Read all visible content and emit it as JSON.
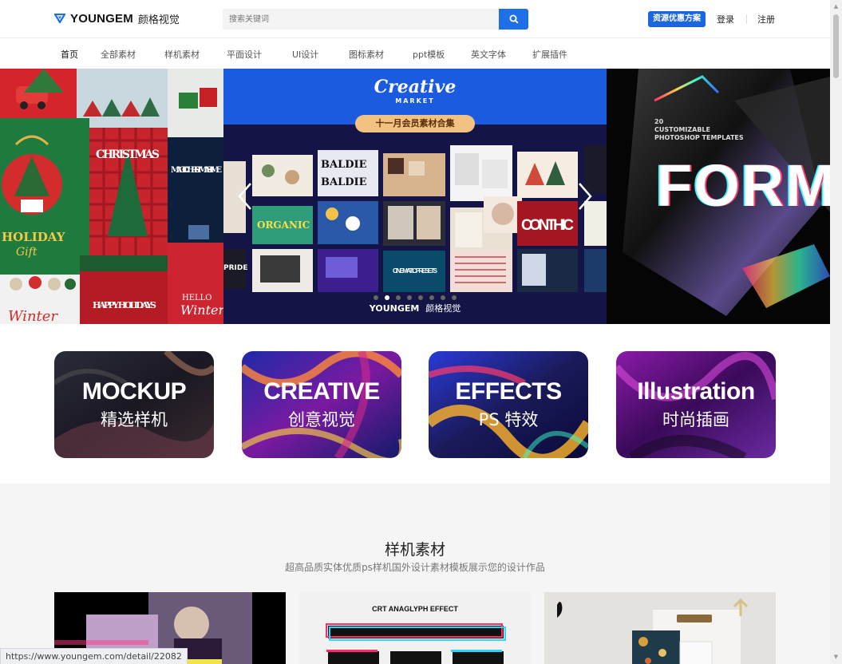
{
  "header": {
    "logo_en": "YOUNGEM",
    "logo_cn": "颜格视觉",
    "search_placeholder": "搜索关键词",
    "promo_label": "资源优惠方案",
    "login_label": "登录",
    "register_label": "注册"
  },
  "nav": {
    "items": [
      {
        "label": "首页"
      },
      {
        "label": "全部素材"
      },
      {
        "label": "样机素材"
      },
      {
        "label": "平面设计"
      },
      {
        "label": "UI设计"
      },
      {
        "label": "图标素材"
      },
      {
        "label": "ppt模板"
      },
      {
        "label": "英文字体"
      },
      {
        "label": "扩展插件"
      }
    ]
  },
  "banner": {
    "left": {
      "holiday": "HOLIDAY",
      "gift": "Gift",
      "magic": "MAGIC CHRISTMAS TIME",
      "christmas_letters": "C H R I S T M A S",
      "happy": "HAPPY HOLIDAYS",
      "winter": "Winter",
      "hello": "HELLO"
    },
    "center": {
      "title": "Creative",
      "subtitle": "MARKET",
      "pill": "十一月会员素材合集",
      "watermark_en": "YOUNGEM",
      "watermark_cn": "颜格视觉",
      "tile_organic": "ORGANIC",
      "tile_conthic": "CONTHIC",
      "tile_cinematic": "CINEMATIC PRESETS",
      "tile_pride": "PRIDE",
      "tile_baldie": "BALDIE"
    },
    "right": {
      "number": "20",
      "line1": "CUSTOMIZABLE",
      "line2": "PHOTOSHOP TEMPLATES",
      "big": "FORM"
    },
    "slide_count": 8,
    "active_slide": 2
  },
  "categories": [
    {
      "en": "MOCKUP",
      "cn": "精选样机"
    },
    {
      "en": "CREATIVE",
      "cn": "创意视觉"
    },
    {
      "en": "EFFECTS",
      "cn": "PS 特效"
    },
    {
      "en": "Illustration",
      "cn": "时尚插画"
    }
  ],
  "section": {
    "title": "样机素材",
    "description": "超高品质实体优质ps样机国外设计素材模板展示您的设计作品",
    "card2_label": "CRT ANAGLYPH EFFECT"
  },
  "status_url": "https://www.youngem.com/detail/22082"
}
